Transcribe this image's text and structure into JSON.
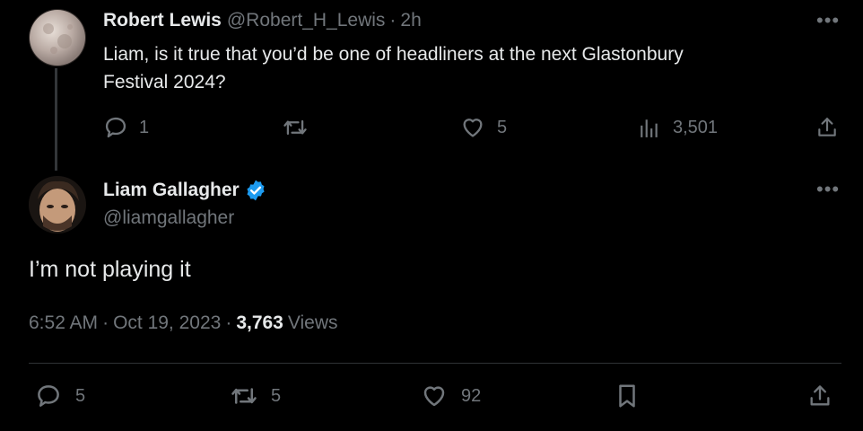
{
  "reply_to": {
    "display_name": "Robert Lewis",
    "handle": "@Robert_H_Lewis",
    "separator": "·",
    "time": "2h",
    "text_line1": "Liam, is it true that you’d be one of headliners at the next Glastonbury",
    "text_line2": "Festival 2024?",
    "actions": {
      "replies": "1",
      "reposts": "",
      "likes": "5",
      "views": "3,501"
    }
  },
  "main_tweet": {
    "display_name": "Liam Gallagher",
    "handle": "@liamgallagher",
    "verified": true,
    "text": "I’m not playing it",
    "time": "6:52 AM",
    "sep1": "·",
    "date": "Oct 19, 2023",
    "sep2": "·",
    "views_count": "3,763",
    "views_label": "Views",
    "actions": {
      "replies": "5",
      "reposts": "5",
      "likes": "92"
    }
  },
  "colors": {
    "background": "#000000",
    "text": "#e7e9ea",
    "muted": "#71767b",
    "verified": "#1d9bf0",
    "divider": "#2f3336"
  },
  "icons": [
    "reply-icon",
    "repost-icon",
    "like-icon",
    "views-icon",
    "share-icon",
    "bookmark-icon",
    "more-icon",
    "verified-badge-icon"
  ]
}
